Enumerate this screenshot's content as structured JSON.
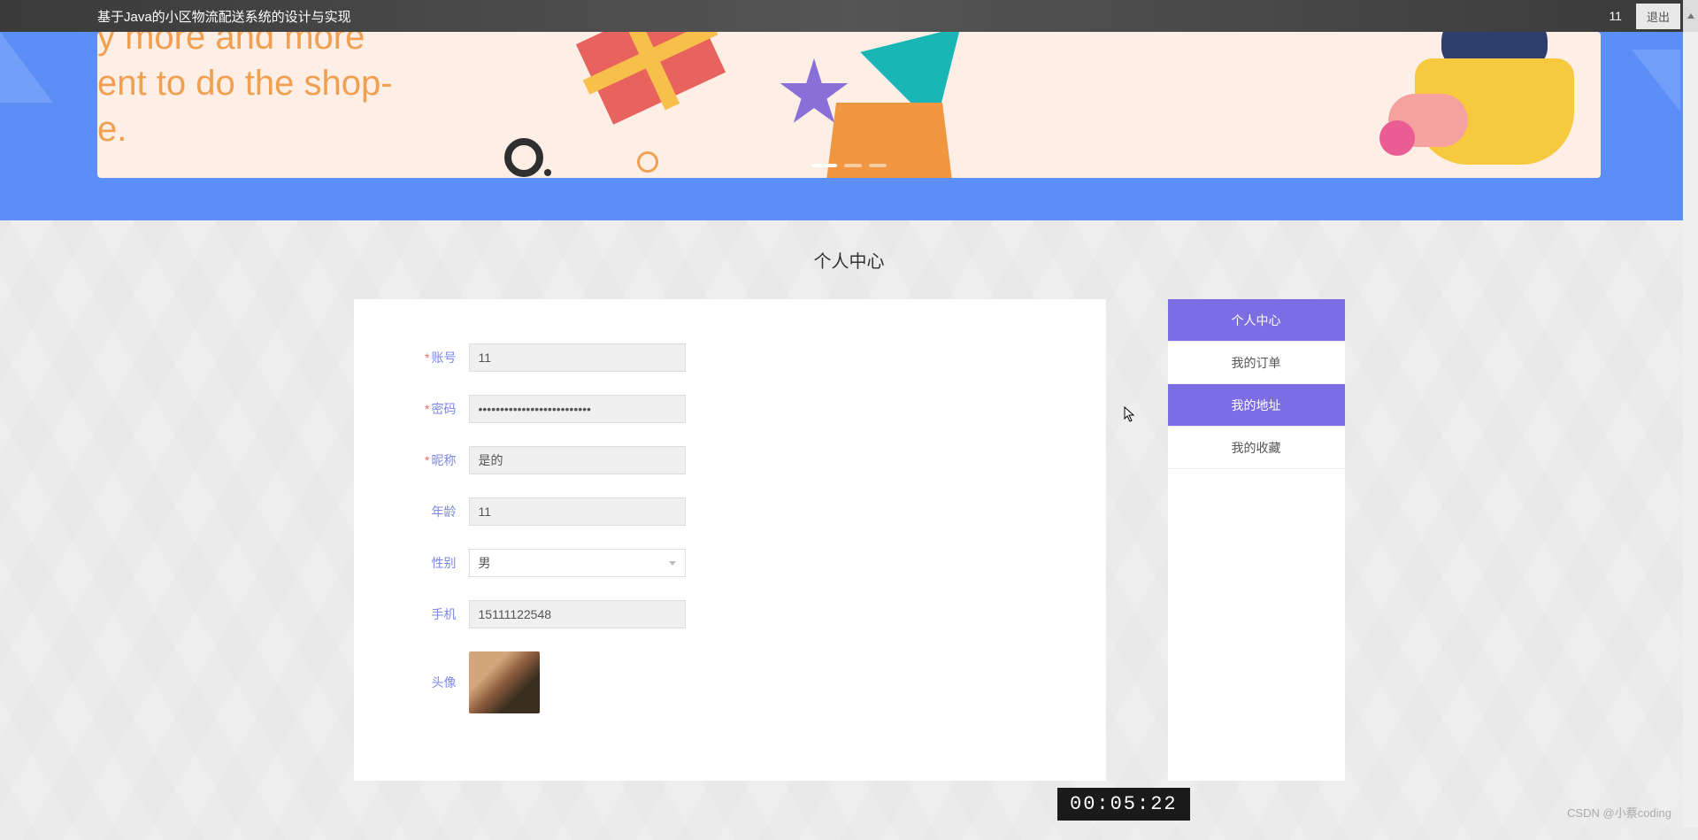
{
  "topbar": {
    "title": "基于Java的小区物流配送系统的设计与实现",
    "user": "11",
    "logout": "退出"
  },
  "hero": {
    "text_line1": "y more and more",
    "text_line2": "ent to do the shop-",
    "text_line3": "e."
  },
  "page": {
    "title": "个人中心"
  },
  "form": {
    "account": {
      "label": "账号",
      "value": "11"
    },
    "password": {
      "label": "密码",
      "value": "••••••••••••••••••••••••••"
    },
    "nickname": {
      "label": "昵称",
      "value": "是的"
    },
    "age": {
      "label": "年龄",
      "value": "11"
    },
    "gender": {
      "label": "性别",
      "value": "男"
    },
    "phone": {
      "label": "手机",
      "value": "15111122548"
    },
    "avatar": {
      "label": "头像"
    }
  },
  "sidebar": {
    "items": [
      {
        "label": "个人中心",
        "active": true
      },
      {
        "label": "我的订单",
        "active": false
      },
      {
        "label": "我的地址",
        "active": true
      },
      {
        "label": "我的收藏",
        "active": false
      }
    ]
  },
  "timer": "00:05:22",
  "watermark": "CSDN @小蔡coding"
}
